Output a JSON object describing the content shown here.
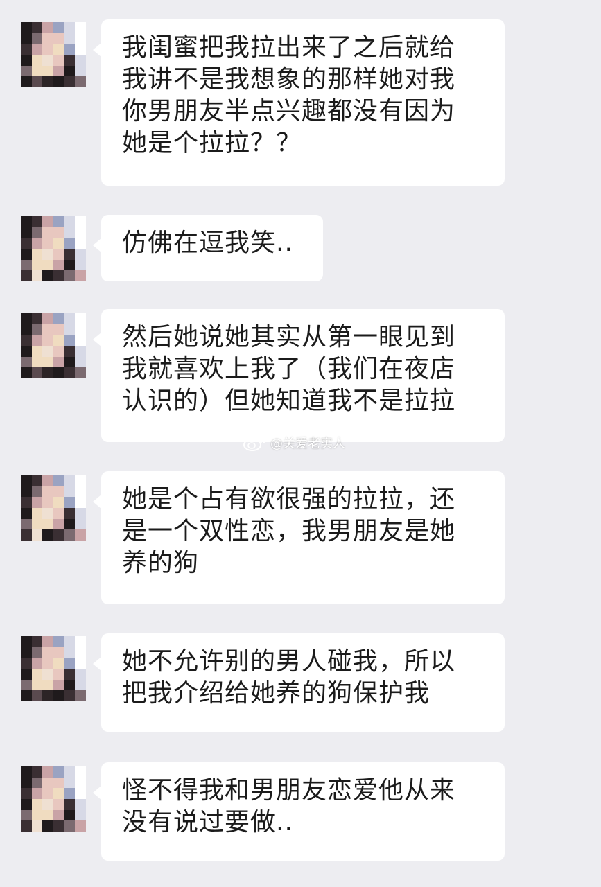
{
  "messages": [
    {
      "text": "我闺蜜把我拉出来了之后就给\n我讲不是我想象的那样她对我\n你男朋友半点兴趣都没有因为\n她是个拉拉？？"
    },
    {
      "text": "仿佛在逗我笑.."
    },
    {
      "text": "然后她说她其实从第一眼见到\n我就喜欢上我了（我们在夜店\n认识的）但她知道我不是拉拉"
    },
    {
      "text": "她是个占有欲很强的拉拉，还\n是一个双性恋，我男朋友是她\n养的狗"
    },
    {
      "text": "她不允许别的男人碰我，所以\n把我介绍给她养的狗保护我"
    },
    {
      "text": "怪不得我和男朋友恋爱他从来\n没有说过要做.."
    }
  ],
  "watermark": {
    "handle": "@关爱老实人",
    "icon": "weibo-icon"
  },
  "colors": {
    "background": "#ededf1",
    "bubble": "#ffffff",
    "text": "#1b1b1b"
  }
}
